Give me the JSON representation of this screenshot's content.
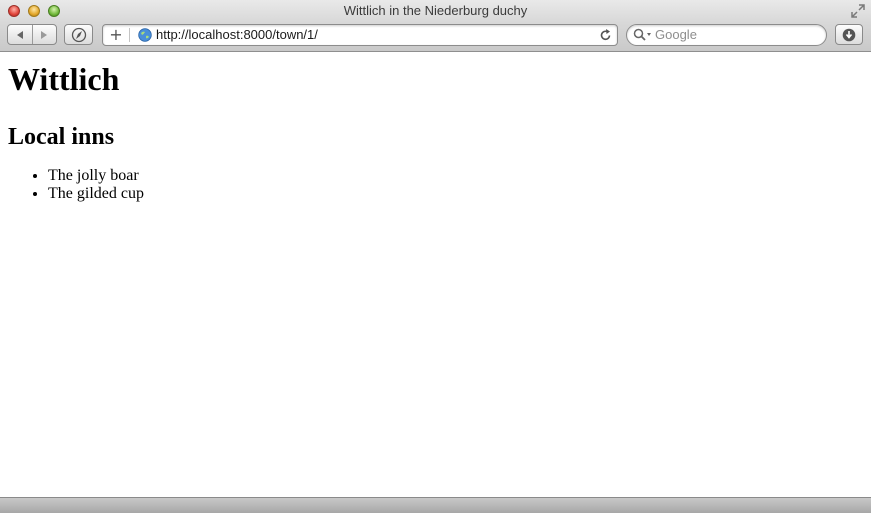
{
  "window": {
    "title": "Wittlich in the Niederburg duchy"
  },
  "toolbar": {
    "url": "http://localhost:8000/town/1/",
    "search_placeholder": "Google",
    "back_icon": "triangle-left",
    "forward_icon": "triangle-right",
    "topsites_icon": "compass",
    "download_icon": "download-arrow"
  },
  "page": {
    "heading": "Wittlich",
    "subheading": "Local inns",
    "inns": [
      "The jolly boar",
      "The gilded cup"
    ]
  },
  "colors": {
    "close": "#e0443a",
    "minimize": "#e3a72a",
    "zoom": "#71b93a"
  }
}
